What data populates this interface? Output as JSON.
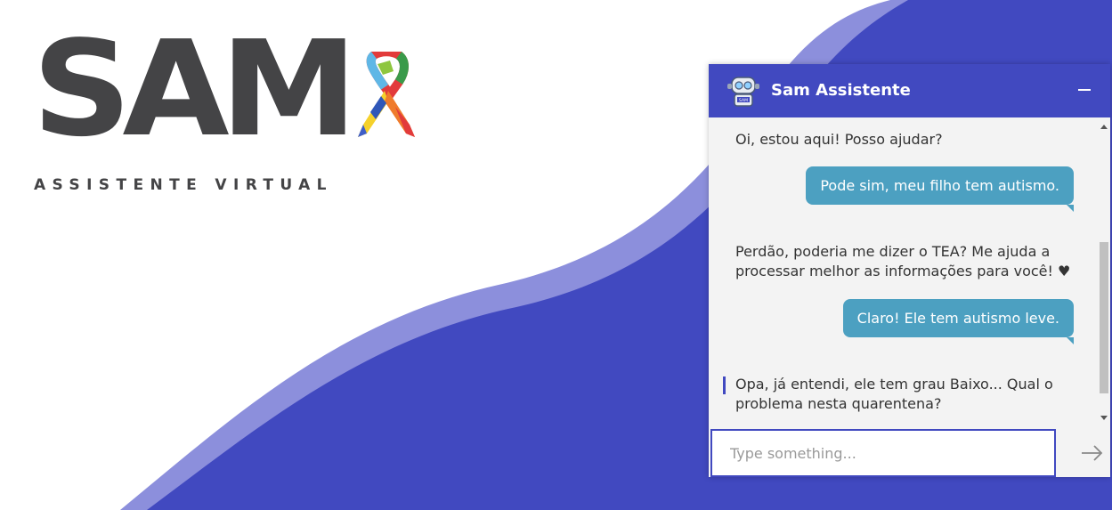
{
  "brand": {
    "wordmark": "SAM",
    "tagline": "ASSISTENTE VIRTUAL",
    "text_color": "#444446",
    "ribbon_icon": "autism-puzzle-ribbon"
  },
  "background": {
    "primary_color": "#4149c0",
    "wave_color": "#8c8fdc"
  },
  "chat": {
    "title": "Sam Assistente",
    "avatar_icon": "robot-icon",
    "minimize_icon": "minimize-icon",
    "header_color": "#4149c0",
    "user_bubble_color": "#4ca0c1",
    "messages": [
      {
        "from": "bot",
        "text": "Oi, estou aqui! Posso ajudar?"
      },
      {
        "from": "user",
        "text": "Pode sim, meu filho tem autismo."
      },
      {
        "from": "bot",
        "line1": "Perdão, poderia me dizer o TEA? Me ajuda a",
        "line2": "processar melhor as informações para você! ♥"
      },
      {
        "from": "user",
        "text": "Claro! Ele tem autismo leve."
      },
      {
        "from": "bot",
        "line1": "Opa, já entendi, ele tem grau Baixo... Qual o",
        "line2": "problema nesta quarentena?"
      }
    ],
    "input": {
      "placeholder": "Type something...",
      "value": ""
    },
    "send_icon": "arrow-right-icon"
  }
}
